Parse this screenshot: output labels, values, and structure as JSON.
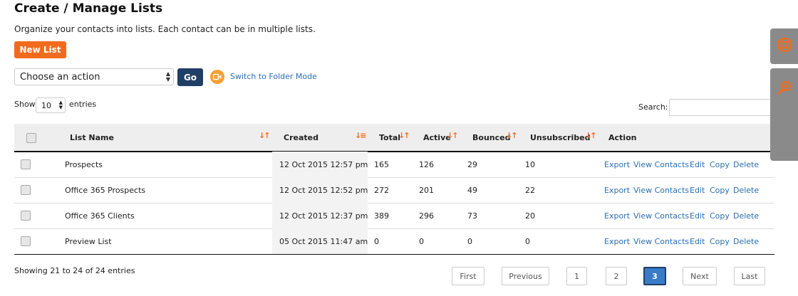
{
  "header": {
    "title": "Create / Manage Lists",
    "subtitle": "Organize your contacts into lists. Each contact can be in multiple lists."
  },
  "toolbar": {
    "new_list_label": "New List",
    "action_select_value": "Choose an action",
    "go_label": "Go",
    "folder_mode_label": "Switch to Folder Mode"
  },
  "table_controls": {
    "show_label": "Show",
    "entries_value": "10",
    "entries_label": "entries",
    "search_label": "Search:"
  },
  "table": {
    "columns": [
      "List Name",
      "Created",
      "Total",
      "Active",
      "Bounced",
      "Unsubscribed",
      "Action"
    ],
    "rows": [
      {
        "name": "Prospects",
        "created": "12 Oct 2015 12:57 pm",
        "total": "165",
        "active": "126",
        "bounced": "29",
        "unsubscribed": "10"
      },
      {
        "name": "Office 365 Prospects",
        "created": "12 Oct 2015 12:52 pm",
        "total": "272",
        "active": "201",
        "bounced": "49",
        "unsubscribed": "22"
      },
      {
        "name": "Office 365 Clients",
        "created": "12 Oct 2015 12:37 pm",
        "total": "389",
        "active": "296",
        "bounced": "73",
        "unsubscribed": "20"
      },
      {
        "name": "Preview List",
        "created": "05 Oct 2015 11:47 am",
        "total": "0",
        "active": "0",
        "bounced": "0",
        "unsubscribed": "0"
      }
    ],
    "actions": [
      "Export",
      "View Contacts",
      "Edit",
      "Copy",
      "Delete"
    ]
  },
  "footer": {
    "showing": "Showing 21 to 24 of 24 entries",
    "pagination": {
      "first": "First",
      "previous": "Previous",
      "pages": [
        "1",
        "2",
        "3"
      ],
      "current_page": "3",
      "next": "Next",
      "last": "Last"
    }
  },
  "icons": {
    "sort": "sort-arrows-icon",
    "help": "lifebuoy-icon",
    "search_panel": "magnifier-icon",
    "folder": "folder-mode-icon"
  },
  "colors": {
    "accent_orange": "#f26b1d",
    "go_navy": "#1f3f66",
    "link_blue": "#2a6fb0",
    "pagination_active": "#3a7bc8",
    "side_tab_gray": "#8a8a8a"
  }
}
